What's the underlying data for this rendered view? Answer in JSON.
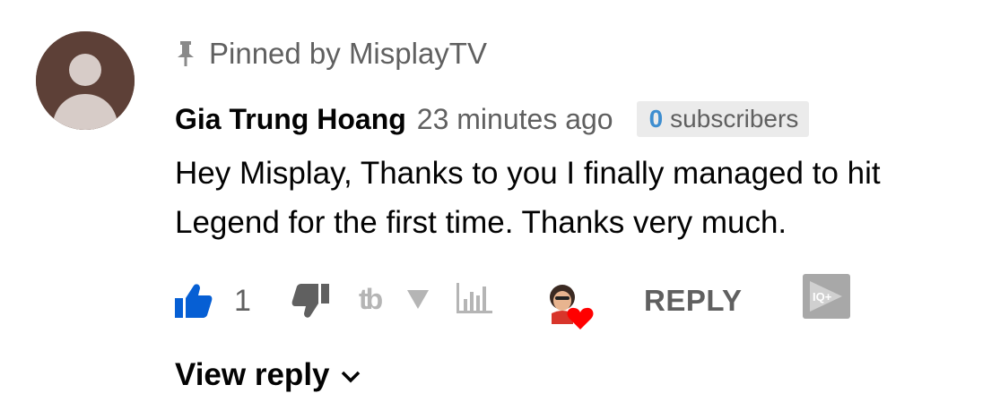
{
  "comment": {
    "pinned_label": "Pinned by MisplayTV",
    "author": "Gia Trung Hoang",
    "time": "23 minutes ago",
    "subscriber_count": "0",
    "subscriber_label": "subscribers",
    "text": "Hey Misplay, Thanks to you I finally managed to hit Legend for the first time. Thanks very much.",
    "like_count": "1",
    "reply_label": "REPLY",
    "view_reply_label": "View reply",
    "extension_logo": "tb",
    "iq_badge": "IQ+"
  },
  "icons": {
    "avatar": "default-avatar-icon",
    "pin": "pin-icon",
    "like": "thumbs-up-icon",
    "dislike": "thumbs-down-icon",
    "arrow": "triangle-down-icon",
    "stats": "bar-chart-icon",
    "creator_heart": "creator-heart-icon",
    "iq": "iq-plus-icon",
    "chevron": "chevron-down-icon"
  },
  "colors": {
    "avatar_bg": "#5d4037",
    "like_active": "#065fd4",
    "heart": "#ff0000",
    "subscriber_count": "#3e8ed0",
    "muted": "#606060"
  }
}
